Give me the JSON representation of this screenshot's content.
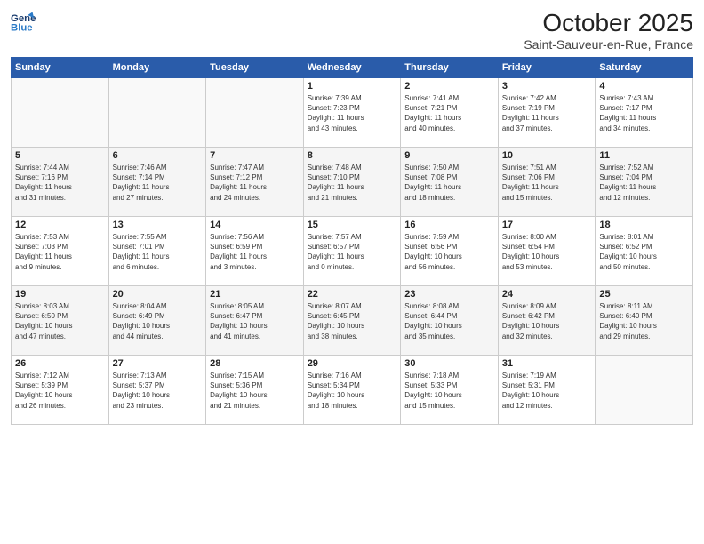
{
  "header": {
    "logo_line1": "General",
    "logo_line2": "Blue",
    "month": "October 2025",
    "location": "Saint-Sauveur-en-Rue, France"
  },
  "days_of_week": [
    "Sunday",
    "Monday",
    "Tuesday",
    "Wednesday",
    "Thursday",
    "Friday",
    "Saturday"
  ],
  "weeks": [
    [
      {
        "day": "",
        "info": ""
      },
      {
        "day": "",
        "info": ""
      },
      {
        "day": "",
        "info": ""
      },
      {
        "day": "1",
        "info": "Sunrise: 7:39 AM\nSunset: 7:23 PM\nDaylight: 11 hours\nand 43 minutes."
      },
      {
        "day": "2",
        "info": "Sunrise: 7:41 AM\nSunset: 7:21 PM\nDaylight: 11 hours\nand 40 minutes."
      },
      {
        "day": "3",
        "info": "Sunrise: 7:42 AM\nSunset: 7:19 PM\nDaylight: 11 hours\nand 37 minutes."
      },
      {
        "day": "4",
        "info": "Sunrise: 7:43 AM\nSunset: 7:17 PM\nDaylight: 11 hours\nand 34 minutes."
      }
    ],
    [
      {
        "day": "5",
        "info": "Sunrise: 7:44 AM\nSunset: 7:16 PM\nDaylight: 11 hours\nand 31 minutes."
      },
      {
        "day": "6",
        "info": "Sunrise: 7:46 AM\nSunset: 7:14 PM\nDaylight: 11 hours\nand 27 minutes."
      },
      {
        "day": "7",
        "info": "Sunrise: 7:47 AM\nSunset: 7:12 PM\nDaylight: 11 hours\nand 24 minutes."
      },
      {
        "day": "8",
        "info": "Sunrise: 7:48 AM\nSunset: 7:10 PM\nDaylight: 11 hours\nand 21 minutes."
      },
      {
        "day": "9",
        "info": "Sunrise: 7:50 AM\nSunset: 7:08 PM\nDaylight: 11 hours\nand 18 minutes."
      },
      {
        "day": "10",
        "info": "Sunrise: 7:51 AM\nSunset: 7:06 PM\nDaylight: 11 hours\nand 15 minutes."
      },
      {
        "day": "11",
        "info": "Sunrise: 7:52 AM\nSunset: 7:04 PM\nDaylight: 11 hours\nand 12 minutes."
      }
    ],
    [
      {
        "day": "12",
        "info": "Sunrise: 7:53 AM\nSunset: 7:03 PM\nDaylight: 11 hours\nand 9 minutes."
      },
      {
        "day": "13",
        "info": "Sunrise: 7:55 AM\nSunset: 7:01 PM\nDaylight: 11 hours\nand 6 minutes."
      },
      {
        "day": "14",
        "info": "Sunrise: 7:56 AM\nSunset: 6:59 PM\nDaylight: 11 hours\nand 3 minutes."
      },
      {
        "day": "15",
        "info": "Sunrise: 7:57 AM\nSunset: 6:57 PM\nDaylight: 11 hours\nand 0 minutes."
      },
      {
        "day": "16",
        "info": "Sunrise: 7:59 AM\nSunset: 6:56 PM\nDaylight: 10 hours\nand 56 minutes."
      },
      {
        "day": "17",
        "info": "Sunrise: 8:00 AM\nSunset: 6:54 PM\nDaylight: 10 hours\nand 53 minutes."
      },
      {
        "day": "18",
        "info": "Sunrise: 8:01 AM\nSunset: 6:52 PM\nDaylight: 10 hours\nand 50 minutes."
      }
    ],
    [
      {
        "day": "19",
        "info": "Sunrise: 8:03 AM\nSunset: 6:50 PM\nDaylight: 10 hours\nand 47 minutes."
      },
      {
        "day": "20",
        "info": "Sunrise: 8:04 AM\nSunset: 6:49 PM\nDaylight: 10 hours\nand 44 minutes."
      },
      {
        "day": "21",
        "info": "Sunrise: 8:05 AM\nSunset: 6:47 PM\nDaylight: 10 hours\nand 41 minutes."
      },
      {
        "day": "22",
        "info": "Sunrise: 8:07 AM\nSunset: 6:45 PM\nDaylight: 10 hours\nand 38 minutes."
      },
      {
        "day": "23",
        "info": "Sunrise: 8:08 AM\nSunset: 6:44 PM\nDaylight: 10 hours\nand 35 minutes."
      },
      {
        "day": "24",
        "info": "Sunrise: 8:09 AM\nSunset: 6:42 PM\nDaylight: 10 hours\nand 32 minutes."
      },
      {
        "day": "25",
        "info": "Sunrise: 8:11 AM\nSunset: 6:40 PM\nDaylight: 10 hours\nand 29 minutes."
      }
    ],
    [
      {
        "day": "26",
        "info": "Sunrise: 7:12 AM\nSunset: 5:39 PM\nDaylight: 10 hours\nand 26 minutes."
      },
      {
        "day": "27",
        "info": "Sunrise: 7:13 AM\nSunset: 5:37 PM\nDaylight: 10 hours\nand 23 minutes."
      },
      {
        "day": "28",
        "info": "Sunrise: 7:15 AM\nSunset: 5:36 PM\nDaylight: 10 hours\nand 21 minutes."
      },
      {
        "day": "29",
        "info": "Sunrise: 7:16 AM\nSunset: 5:34 PM\nDaylight: 10 hours\nand 18 minutes."
      },
      {
        "day": "30",
        "info": "Sunrise: 7:18 AM\nSunset: 5:33 PM\nDaylight: 10 hours\nand 15 minutes."
      },
      {
        "day": "31",
        "info": "Sunrise: 7:19 AM\nSunset: 5:31 PM\nDaylight: 10 hours\nand 12 minutes."
      },
      {
        "day": "",
        "info": ""
      }
    ]
  ]
}
